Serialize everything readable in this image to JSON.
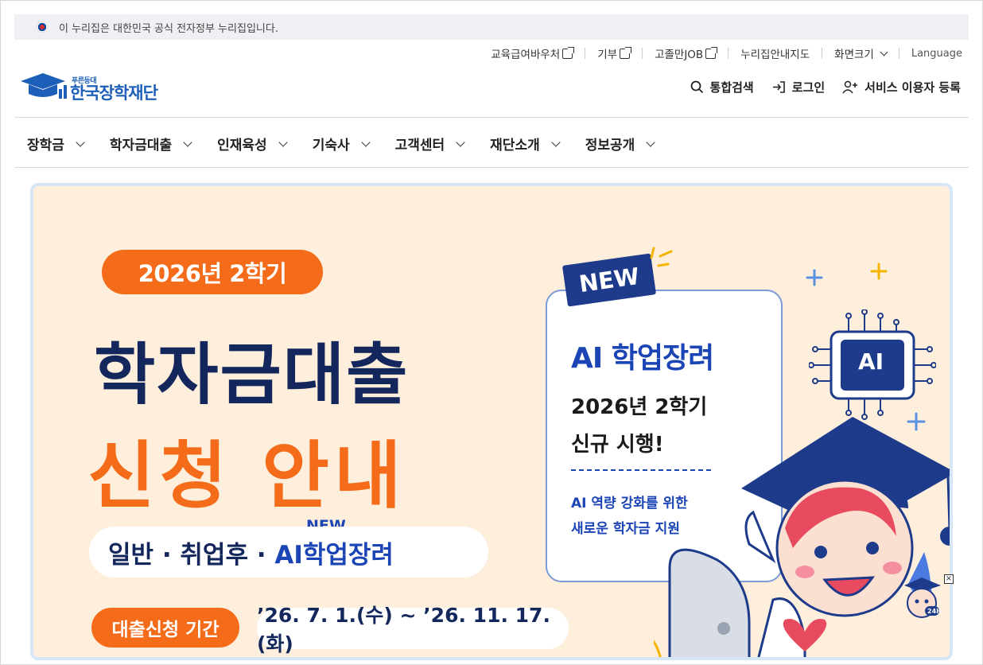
{
  "gov_notice": "이 누리집은 대한민국 공식 전자정부 누리집입니다.",
  "util_links": [
    {
      "label": "교육급여바우처",
      "external": true
    },
    {
      "label": "기부",
      "external": true
    },
    {
      "label": "고졸만JOB",
      "external": true
    },
    {
      "label": "누리집안내지도",
      "external": false
    },
    {
      "label": "화면크기",
      "dropdown": true
    },
    {
      "label": "Language",
      "external": false
    }
  ],
  "logo": {
    "sub": "푸른등대",
    "main": "한국장학재단"
  },
  "tools": {
    "search": "통합검색",
    "login": "로그인",
    "register": "서비스 이용자 등록"
  },
  "nav": [
    "장학금",
    "학자금대출",
    "인재육성",
    "기숙사",
    "고객센터",
    "재단소개",
    "정보공개"
  ],
  "banner": {
    "semester": "2026년 2학기",
    "title_line1": "학자금대출",
    "title_line2": "신청 안내",
    "types_prefix": "일반 · 취업후 · ",
    "types_ai": "AI학업장려",
    "types_new": "NEW",
    "period_label": "대출신청 기간",
    "period_value": "’26. 7. 1.(수) ~ ’26. 11. 17.(화)",
    "card": {
      "new_tag": "NEW",
      "heading": "AI 학업장려",
      "line1": "2026년 2학기",
      "line2": "신규 시행!",
      "desc1": "AI 역량 강화를 위한",
      "desc2": "새로운 학자금 지원"
    },
    "chip_label": "AI"
  },
  "floating": {
    "badge": "24H",
    "close": "×"
  },
  "colors": {
    "brand_blue": "#1d5fb8",
    "orange": "#f46b1a",
    "navy": "#14275d",
    "banner_bg": "#fdefdc"
  }
}
